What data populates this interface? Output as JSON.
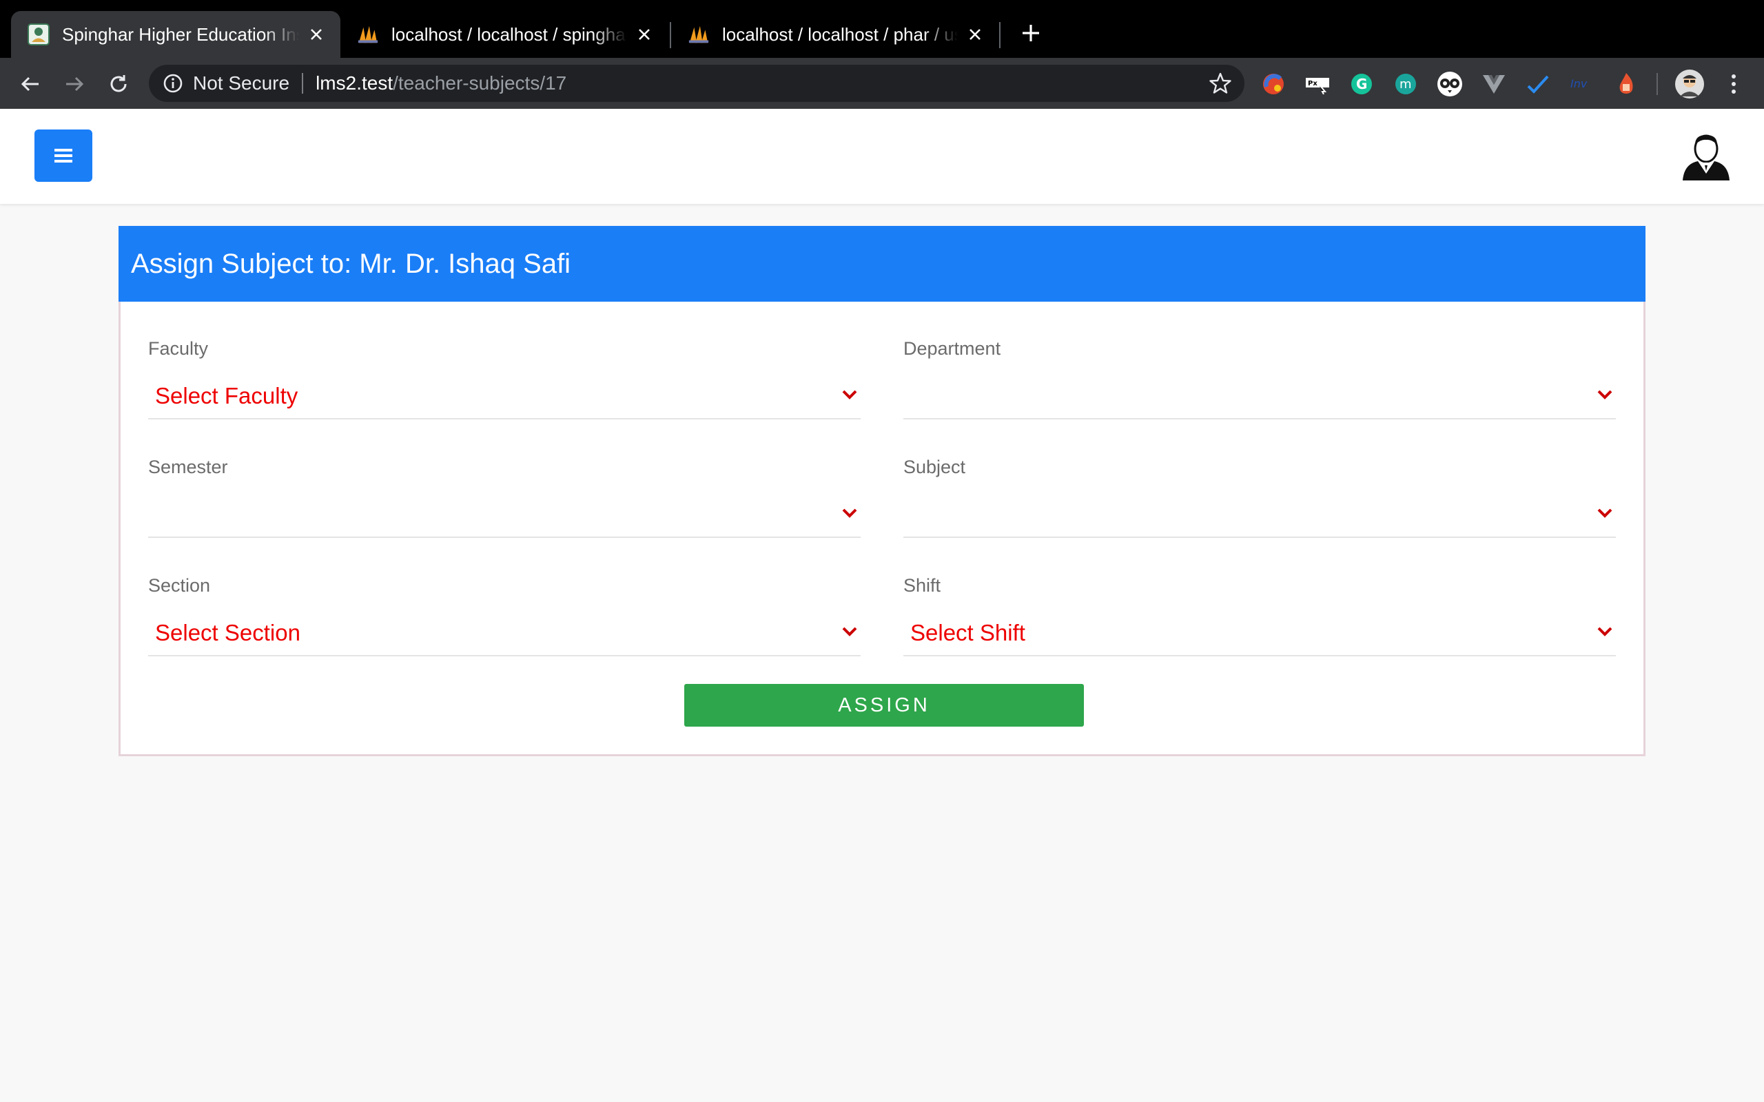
{
  "browser": {
    "tabs": [
      {
        "title": "Spinghar Higher Education Institute",
        "active": true,
        "favicon": "spinghar-logo-icon"
      },
      {
        "title": "localhost / localhost / spinghar",
        "active": false,
        "favicon": "phpmyadmin-icon"
      },
      {
        "title": "localhost / localhost / phar / users",
        "active": false,
        "favicon": "phpmyadmin-icon"
      }
    ],
    "address": {
      "security_label": "Not Secure",
      "host": "lms2.test",
      "path": "/teacher-subjects/17"
    },
    "extensions": [
      "color-picker-icon",
      "page-ruler-icon",
      "grammarly-icon",
      "mercury-icon",
      "owl-icon",
      "vue-devtools-icon",
      "todo-check-icon",
      "inv-icon",
      "fire-extension-icon"
    ]
  },
  "page": {
    "card_title": "Assign Subject to: Mr. Dr. Ishaq Safi",
    "fields": {
      "faculty": {
        "label": "Faculty",
        "value": "Select Faculty"
      },
      "department": {
        "label": "Department",
        "value": ""
      },
      "semester": {
        "label": "Semester",
        "value": ""
      },
      "subject": {
        "label": "Subject",
        "value": ""
      },
      "section": {
        "label": "Section",
        "value": "Select Section"
      },
      "shift": {
        "label": "Shift",
        "value": "Select Shift"
      }
    },
    "assign_button": "ASSIGN"
  },
  "colors": {
    "primary": "#1a7ef7",
    "success": "#2ea64b",
    "placeholder_red": "#ee0000"
  }
}
